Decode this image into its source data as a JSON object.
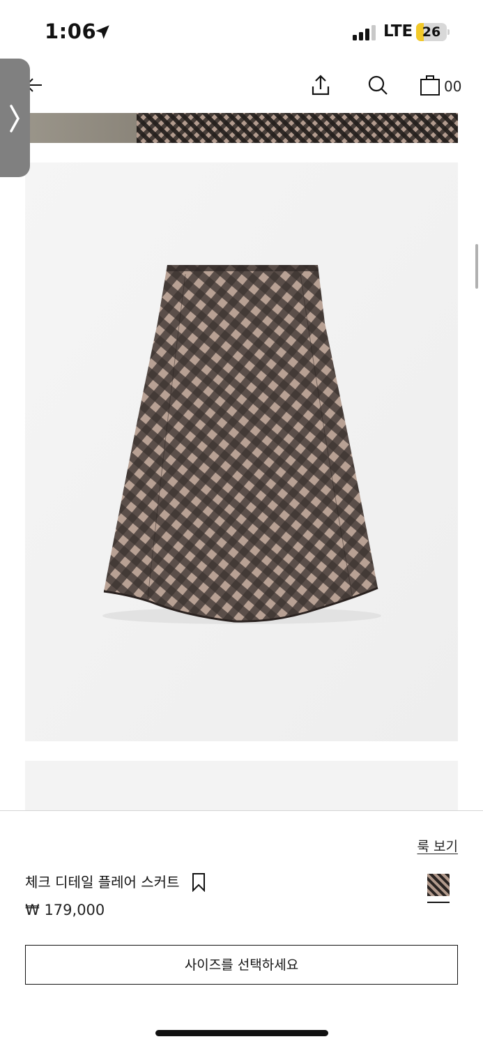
{
  "status_bar": {
    "time": "1:06",
    "network": "LTE",
    "battery_level": "26",
    "battery_percent": 26,
    "icons": [
      "location-arrow-icon",
      "signal-bars-icon"
    ]
  },
  "nav": {
    "icons": [
      "back-arrow-icon",
      "share-icon",
      "search-icon",
      "shopping-bag-icon"
    ],
    "cart_count": "00"
  },
  "side_handle": {
    "icon": "chevron-right-icon"
  },
  "product": {
    "look_link": "룩 보기",
    "name": "체크 디테일 플레어 스커트",
    "price": "₩ 179,000",
    "size_button": "사이즈를 선택하세요",
    "bookmark_icon": "bookmark-icon"
  },
  "colors": {
    "check_dark": "#2a2422",
    "check_light": "#b49d8f",
    "image_bg": "#f2f2f2",
    "battery_accent": "#f2c928"
  }
}
